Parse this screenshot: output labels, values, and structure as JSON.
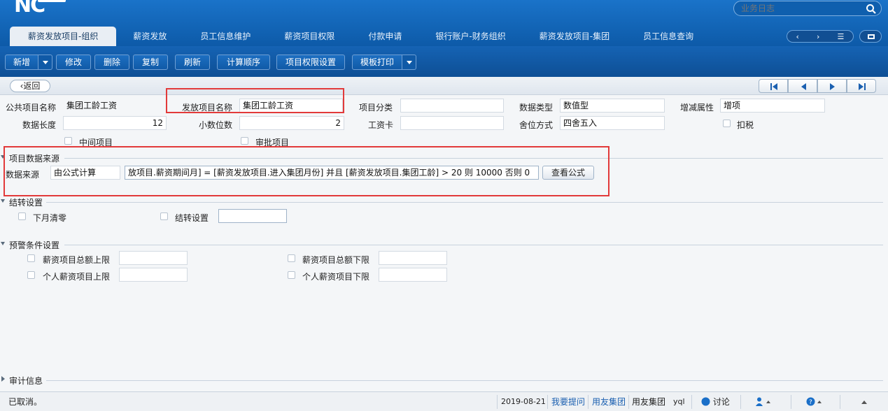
{
  "header": {
    "logo_text": "NC",
    "search_placeholder": "业务日志"
  },
  "tabs": [
    {
      "label": "薪资发放项目-组织",
      "active": true
    },
    {
      "label": "薪资发放"
    },
    {
      "label": "员工信息维护"
    },
    {
      "label": "薪资项目权限"
    },
    {
      "label": "付款申请"
    },
    {
      "label": "银行账户-财务组织"
    },
    {
      "label": "薪资发放项目-集团"
    },
    {
      "label": "员工信息查询"
    }
  ],
  "tabnav": {
    "prev": "‹",
    "next": "›",
    "menu": "☰"
  },
  "toolbar": {
    "add": "新增",
    "edit": "修改",
    "delete": "删除",
    "copy": "复制",
    "refresh": "刷新",
    "calc_order": "计算顺序",
    "item_permission": "项目权限设置",
    "template_print": "模板打印"
  },
  "subbar": {
    "back": "返回"
  },
  "form": {
    "public_item_name_label": "公共项目名称",
    "public_item_name": "集团工龄工资",
    "issue_item_name_label": "发放项目名称",
    "issue_item_name": "集团工龄工资",
    "item_category_label": "项目分类",
    "item_category": "",
    "data_type_label": "数据类型",
    "data_type": "数值型",
    "increase_attr_label": "增减属性",
    "increase_attr": "增项",
    "data_length_label": "数据长度",
    "data_length": "12",
    "decimal_places_label": "小数位数",
    "decimal_places": "2",
    "salary_card_label": "工资卡",
    "salary_card": "",
    "rounding_label": "舍位方式",
    "rounding": "四舍五入",
    "tax_label": "扣税",
    "intermediate_label": "中间项目",
    "approval_label": "审批项目"
  },
  "source_section": {
    "title": "项目数据来源",
    "source_label": "数据来源",
    "source_value": "由公式计算",
    "formula": "放项目.薪资期间月] = [薪资发放项目.进入集团月份] 并且 [薪资发放项目.集团工龄] > 20 则 10000 否则 0",
    "view_formula": "查看公式"
  },
  "carry_section": {
    "title": "结转设置",
    "clear_next_month": "下月清零",
    "carry_setting": "结转设置"
  },
  "warning_section": {
    "title": "预警条件设置",
    "total_upper": "薪资项目总额上限",
    "total_lower": "薪资项目总额下限",
    "person_upper": "个人薪资项目上限",
    "person_lower": "个人薪资项目下限"
  },
  "audit_section": {
    "title": "审计信息"
  },
  "statusbar": {
    "message": "已取消。",
    "date": "2019-08-21",
    "ask": "我要提问",
    "group1": "用友集团",
    "group2": "用友集团",
    "user": "yql",
    "discuss": "讨论"
  }
}
